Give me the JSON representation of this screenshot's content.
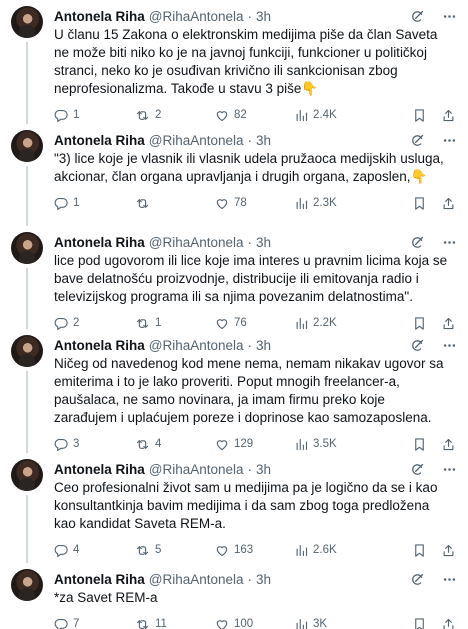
{
  "author": {
    "name": "Antonela Riha",
    "handle": "@RihaAntonela",
    "separator": "·",
    "time": "3h"
  },
  "tweets": [
    {
      "text": "U članu 15 Zakona o elektronskim medijima piše da član Saveta ne može biti niko ko je na javnoj funkciji, funkcioner u političkoj stranci, neko ko je osuđivan krivično ili sankcionisan zbog neprofesionalizma. Takođe u stavu 3 piše👇",
      "replies": "1",
      "reposts": "2",
      "likes": "82",
      "views": "2.4K"
    },
    {
      "text": "\"3) lice koje je vlasnik ili vlasnik udela pružaoca medijskih usluga, akcionar, član organa upravljanja i drugih organa, zaposlen,👇",
      "replies": "1",
      "reposts": "",
      "likes": "78",
      "views": "2.3K"
    },
    {
      "text": "lice pod ugovorom ili lice koje ima interes u pravnim licima koja se bave delatnošću proizvodnje, distribucije ili emitovanja radio i televizijskog programa ili sa njima povezanim delatnostima\".",
      "replies": "2",
      "reposts": "1",
      "likes": "76",
      "views": "2.2K"
    },
    {
      "text": "Ničeg od navedenog kod mene nema, nemam nikakav ugovor sa emiterima i to je lako proveriti. Poput mnogih freelancer-a, paušalaca, ne samo novinara, ja imam firmu preko koje zarađujem i uplaćujem poreze i doprinose kao samozaposlena.",
      "replies": "3",
      "reposts": "4",
      "likes": "129",
      "views": "3.5K"
    },
    {
      "text": "Ceo profesionalni život sam u medijima pa je logično da se i kao konsultantkinja bavim medijima i da sam zbog toga predložena kao kandidat Saveta REM-a.",
      "replies": "4",
      "reposts": "5",
      "likes": "163",
      "views": "2.6K"
    },
    {
      "text": "*za Savet REM-a",
      "replies": "7",
      "reposts": "11",
      "likes": "100",
      "views": "3K"
    }
  ],
  "icons": {
    "grok": "grok-icon",
    "more": "more-icon",
    "reply": "reply-icon",
    "repost": "repost-icon",
    "like": "like-icon",
    "views": "views-icon",
    "bookmark": "bookmark-icon",
    "share": "share-icon"
  },
  "colors": {
    "text": "#0f1419",
    "secondary": "#536471",
    "thread_line": "#cfd9de"
  }
}
